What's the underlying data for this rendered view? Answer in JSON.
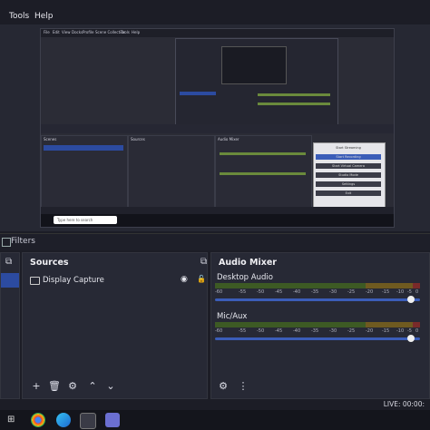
{
  "menubar": {
    "items": [
      {
        "label": "Tools"
      },
      {
        "label": "Help"
      }
    ]
  },
  "preview": {
    "menu": [
      "File",
      "Edit",
      "View",
      "Docks",
      "Profile",
      "Scene Collection",
      "Tools",
      "Help"
    ],
    "search_placeholder": "Type here to search",
    "dropdown_items": [
      "Start Streaming",
      "Start Recording",
      "Start Virtual Camera",
      "Studio Mode",
      "Settings",
      "Exit"
    ],
    "docks": [
      "Scenes",
      "Sources",
      "Audio Mixer"
    ],
    "scene_item": "Scene",
    "source_item": "Display Capture"
  },
  "filters_bar": {
    "label": "Filters"
  },
  "sources": {
    "title": "Sources",
    "items": [
      {
        "label": "Display Capture"
      }
    ]
  },
  "audio_mixer": {
    "title": "Audio Mixer",
    "channels": [
      {
        "name": "Desktop Audio",
        "volume": 1.0
      },
      {
        "name": "Mic/Aux",
        "volume": 1.0
      }
    ],
    "ticks": [
      "-60",
      "-55",
      "-50",
      "-45",
      "-40",
      "-35",
      "-30",
      "-25",
      "-20",
      "-15",
      "-10",
      "-5",
      "0"
    ]
  },
  "status": {
    "live": "LIVE: 00:00:"
  },
  "colors": {
    "accent": "#3b5db8",
    "selected": "#2c4ba0",
    "meter_green": "#3d5a24"
  }
}
